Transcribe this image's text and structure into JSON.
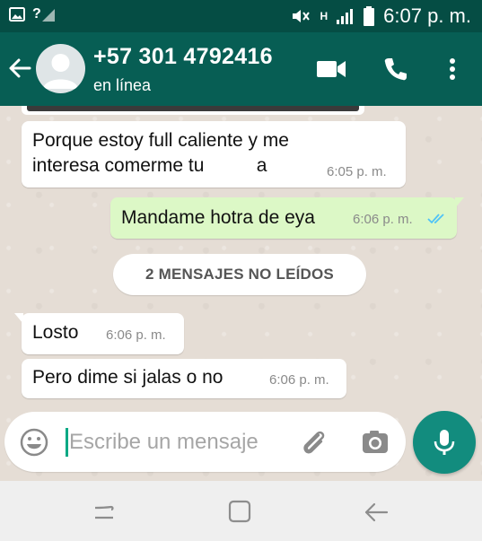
{
  "status_bar": {
    "signal_label": "?",
    "network_label": "H",
    "time": "6:07 p. m."
  },
  "header": {
    "contact_name": "+57 301 4792416",
    "contact_status": "en línea"
  },
  "messages": [
    {
      "direction": "in",
      "lines": [
        "Porque estoy full caliente y me",
        "interesa comerme tu          a"
      ],
      "time": "6:05 p. m."
    },
    {
      "direction": "out",
      "lines": [
        "Mandame hotra de eya"
      ],
      "time": "6:06 p. m.",
      "read": true
    },
    {
      "direction": "in",
      "lines": [
        "Losto"
      ],
      "time": "6:06 p. m."
    },
    {
      "direction": "in",
      "lines": [
        "Pero dime si jalas o no"
      ],
      "time": "6:06 p. m."
    }
  ],
  "unread_badge": "2 MENSAJES NO LEÍDOS",
  "composer": {
    "placeholder": "Escribe un mensaje"
  },
  "colors": {
    "header": "#075e54",
    "status_bar": "#054d44",
    "outgoing_bubble": "#dcf8c6",
    "mic_button": "#128c7e",
    "read_ticks": "#4fc3f7"
  }
}
